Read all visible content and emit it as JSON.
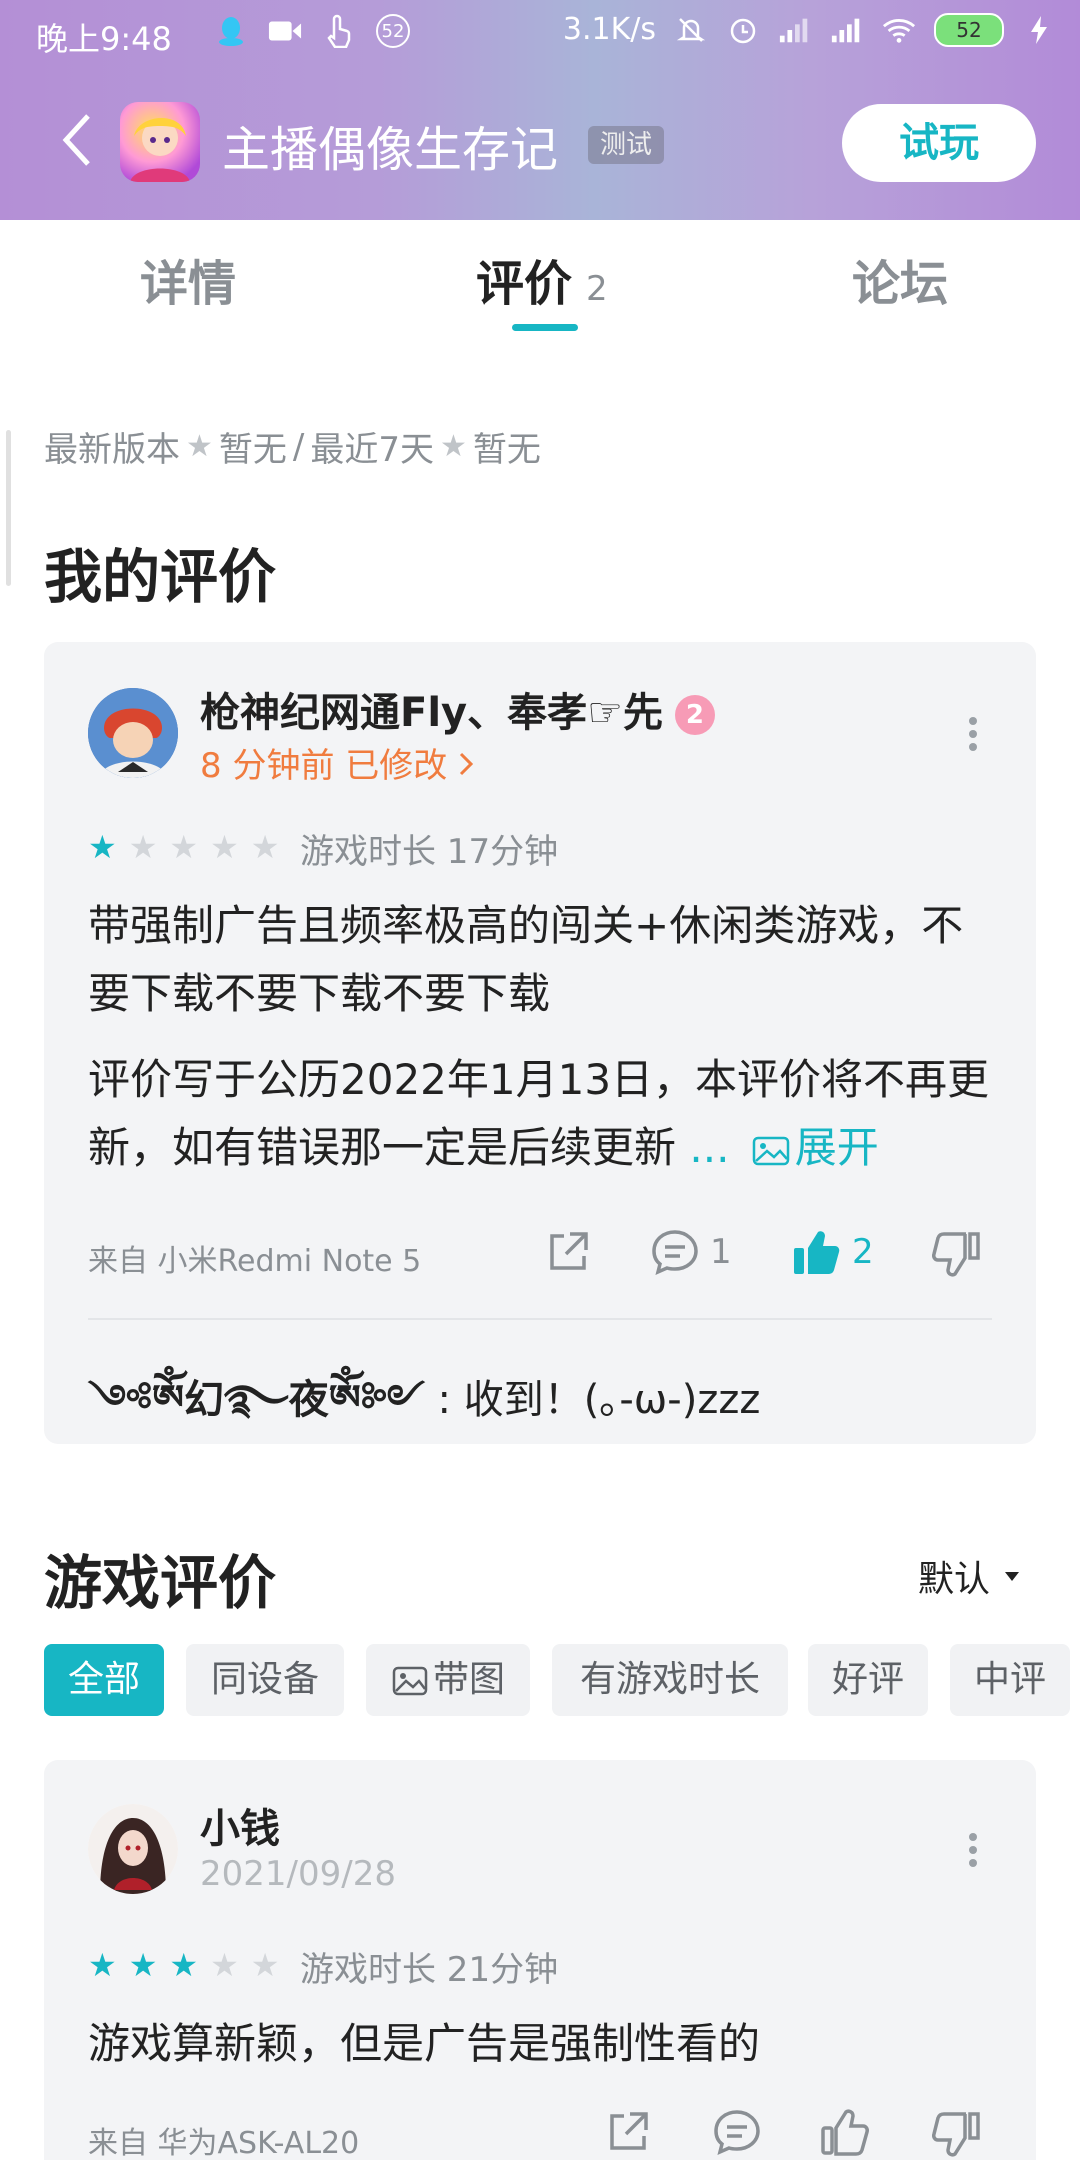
{
  "status_bar": {
    "time": "晚上9:48",
    "notification_count": "52",
    "network_speed": "3.1K/s",
    "battery": "52"
  },
  "header": {
    "app_title": "主播偶像生存记",
    "test_tag": "测试",
    "try_button": "试玩"
  },
  "tabs": {
    "details": "详情",
    "reviews": "评价",
    "reviews_count": "2",
    "forum": "论坛"
  },
  "rating_summary": {
    "latest_label": "最新版本",
    "latest_value": "暂无",
    "separator": "/",
    "recent_label": "最近7天",
    "recent_value": "暂无"
  },
  "my_review": {
    "section_title": "我的评价",
    "user_name": "枪神纪网通Fly、奉孝☞先",
    "level": "2",
    "time_ago": "8 分钟前",
    "modified": "已修改",
    "rating": 1,
    "play_time": "游戏时长 17分钟",
    "text_1": "带强制广告且频率极高的闯关+休闲类游戏，不要下载不要下载不要下载",
    "text_2": "评价写于公历2022年1月13日，本评价将不再更新，如有错误那一定是后续更新",
    "ellipsis": "...",
    "expand_label": "展开",
    "device": "来自 小米Redmi Note 5",
    "comment_count": "1",
    "like_count": "2",
    "reply_author": "༺ༀ幻࿐夜ༀ༻",
    "reply_sep": " : ",
    "reply_text": "收到！(｡-ω-)zzz"
  },
  "game_reviews": {
    "section_title": "游戏评价",
    "sort_label": "默认",
    "filters": [
      "全部",
      "同设备",
      "带图",
      "有游戏时长",
      "好评",
      "中评"
    ]
  },
  "review_1": {
    "user_name": "小钱",
    "date": "2021/09/28",
    "rating": 3,
    "play_time": "游戏时长 21分钟",
    "text": "游戏算新颖，但是广告是强制性看的",
    "device": "来自 华为ASK-AL20"
  },
  "colors": {
    "accent": "#17b6c4",
    "orange": "#f07c3f",
    "gray_text": "#8a8f94"
  }
}
